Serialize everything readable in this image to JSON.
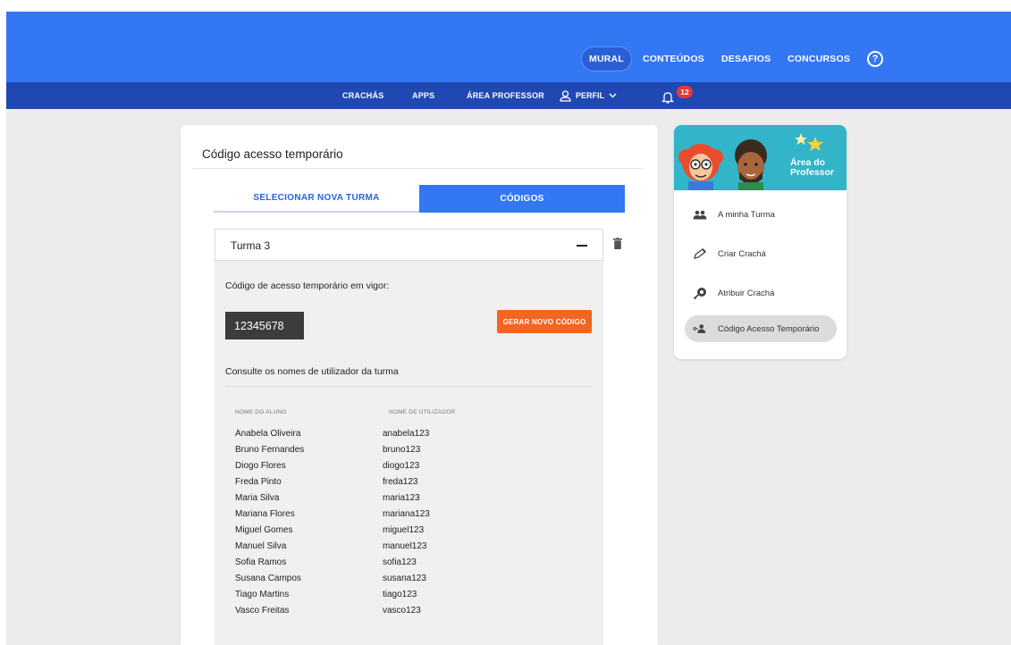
{
  "topnav": {
    "items": [
      "MURAL",
      "CONTEÚDOS",
      "DESAFIOS",
      "CONCURSOS"
    ],
    "help_icon": "?"
  },
  "subnav": {
    "items": [
      "CRACHÁS",
      "APPS",
      "ÁREA PROFESSOR"
    ],
    "perfil": "PERFIL",
    "notifications": "12"
  },
  "main": {
    "title": "Código acesso temporário",
    "tabs": [
      "SELECIONAR NOVA TURMA",
      "CÓDIGOS"
    ],
    "turma": "Turma 3",
    "codigo_label": "Código de acesso temporário em vigor:",
    "codigo_value": "12345678",
    "gerar_button": "GERAR NOVO CÓDIGO",
    "consulte": "Consulte os nomes de utilizador da turma",
    "columns": [
      "NOME DO ALUNO",
      "NOME DE UTILIZADOR"
    ],
    "students": [
      [
        "Anabela Oliveira",
        "anabela123"
      ],
      [
        "Bruno Fernandes",
        "bruno123"
      ],
      [
        "Diogo Flores",
        "diogo123"
      ],
      [
        "Freda Pinto",
        "freda123"
      ],
      [
        "Maria Silva",
        "maria123"
      ],
      [
        "Mariana Flores",
        "mariana123"
      ],
      [
        "Miguel Gomes",
        "miguel123"
      ],
      [
        "Manuel Silva",
        "manuel123"
      ],
      [
        "Sofia Ramos",
        "sofia123"
      ],
      [
        "Susana Campos",
        "susana123"
      ],
      [
        "Tiago Martins",
        "tiago123"
      ],
      [
        "Vasco Freitas",
        "vasco123"
      ]
    ]
  },
  "sidebar": {
    "hero_title_1": "Área do",
    "hero_title_2": "Professor",
    "items": [
      {
        "label": "A minha Turma",
        "icon": "group-icon"
      },
      {
        "label": "Criar Crachá",
        "icon": "pencil-icon"
      },
      {
        "label": "Atribuir Crachá",
        "icon": "badge-assign-icon"
      },
      {
        "label": "Código Acesso Temporário",
        "icon": "person-key-icon"
      }
    ],
    "active_index": 3
  },
  "colors": {
    "primary": "#3477f5",
    "primary_dark": "#1f48b3",
    "accent_orange": "#f26522",
    "badge_red": "#e53935",
    "hero_teal": "#33b4c8"
  }
}
